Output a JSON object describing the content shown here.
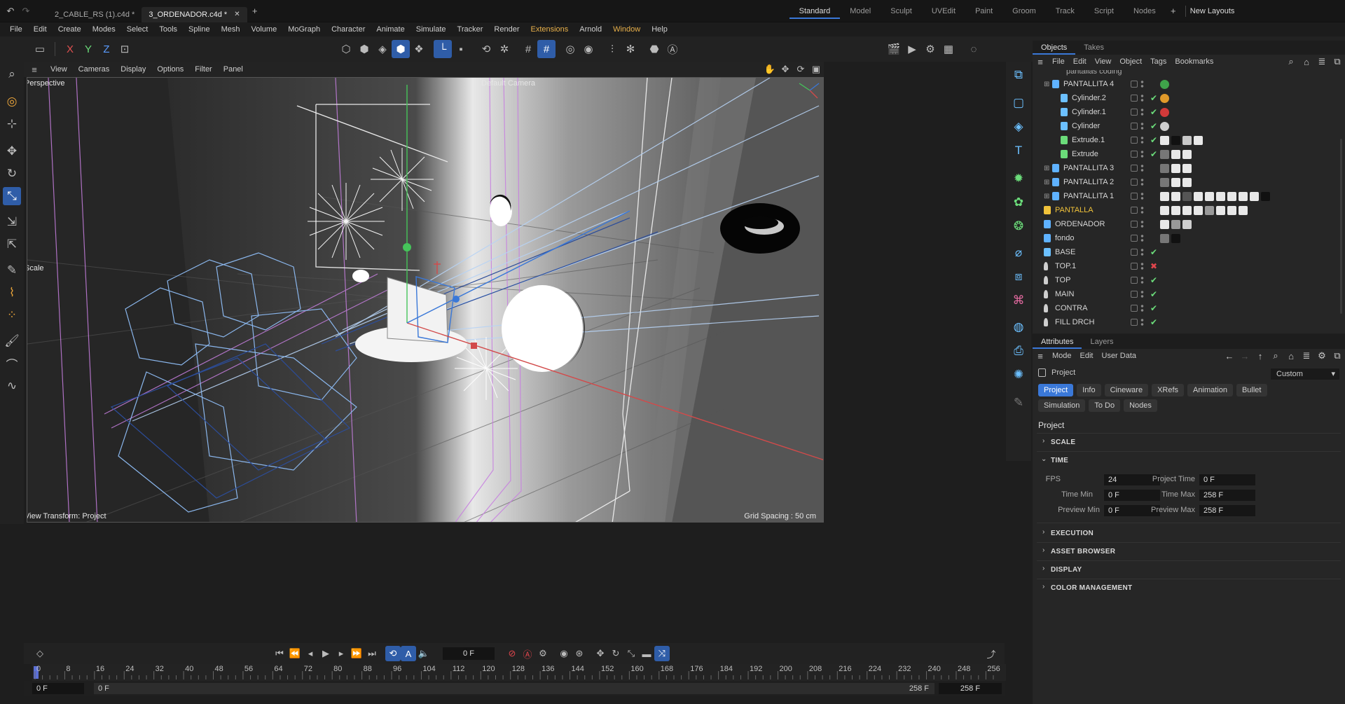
{
  "top_bar": {
    "file_tabs": [
      {
        "label": "2_CABLE_RS (1).c4d *",
        "current": false
      },
      {
        "label": "3_ORDENADOR.c4d *",
        "current": true
      }
    ],
    "add_tab_icon": "plus-icon",
    "layouts": [
      "Standard",
      "Model",
      "Sculpt",
      "UVEdit",
      "Paint",
      "Groom",
      "Track",
      "Script",
      "Nodes"
    ],
    "active_layout": "Standard",
    "new_layouts_label": "New Layouts"
  },
  "menu": [
    "File",
    "Edit",
    "Create",
    "Modes",
    "Select",
    "Tools",
    "Spline",
    "Mesh",
    "Volume",
    "MoGraph",
    "Character",
    "Animate",
    "Simulate",
    "Tracker",
    "Render",
    "Extensions",
    "Arnold",
    "Window",
    "Help"
  ],
  "viewport": {
    "menu": [
      "View",
      "Cameras",
      "Display",
      "Options",
      "Filter",
      "Panel"
    ],
    "projection_label": "Perspective",
    "camera_label": "Default Camera",
    "tool_label": "Scale",
    "view_transform": "View Transform: Project",
    "grid_spacing": "Grid Spacing : 50 cm"
  },
  "objects_panel": {
    "tabs": [
      "Objects",
      "Takes"
    ],
    "active_tab": "Objects",
    "menu": [
      "File",
      "Edit",
      "View",
      "Object",
      "Tags",
      "Bookmarks"
    ],
    "partial_row": "pantallas coding",
    "rows": [
      {
        "name": "PANTALLITA  4",
        "kind": "null",
        "indent": 2,
        "check": "none"
      },
      {
        "name": "Cylinder.2",
        "kind": "cylinder",
        "indent": 3,
        "check": "green"
      },
      {
        "name": "Cylinder.1",
        "kind": "cylinder",
        "indent": 3,
        "check": "green"
      },
      {
        "name": "Cylinder",
        "kind": "cylinder",
        "indent": 3,
        "check": "green"
      },
      {
        "name": "Extrude.1",
        "kind": "extrude",
        "indent": 3,
        "check": "green"
      },
      {
        "name": "Extrude",
        "kind": "extrude",
        "indent": 3,
        "check": "green"
      },
      {
        "name": "PANTALLITA 3",
        "kind": "null",
        "indent": 2,
        "check": "none"
      },
      {
        "name": "PANTALLITA 2",
        "kind": "null",
        "indent": 2,
        "check": "none"
      },
      {
        "name": "PANTALLITA 1",
        "kind": "null",
        "indent": 2,
        "check": "none"
      },
      {
        "name": "PANTALLA",
        "kind": "null-highlight",
        "indent": 1,
        "check": "none"
      },
      {
        "name": "ORDENADOR",
        "kind": "null",
        "indent": 1,
        "check": "none"
      },
      {
        "name": "fondo",
        "kind": "null",
        "indent": 1,
        "check": "none"
      },
      {
        "name": "BASE",
        "kind": "cylinder",
        "indent": 1,
        "check": "green"
      },
      {
        "name": "TOP.1",
        "kind": "light",
        "indent": 1,
        "check": "red"
      },
      {
        "name": "TOP",
        "kind": "light",
        "indent": 1,
        "check": "green"
      },
      {
        "name": "MAIN",
        "kind": "light",
        "indent": 1,
        "check": "green"
      },
      {
        "name": "CONTRA",
        "kind": "light",
        "indent": 1,
        "check": "green"
      },
      {
        "name": "FILL DRCH",
        "kind": "light",
        "indent": 1,
        "check": "green"
      }
    ]
  },
  "attributes_panel": {
    "tabs": [
      "Attributes",
      "Layers"
    ],
    "active_tab": "Attributes",
    "menu": [
      "Mode",
      "Edit",
      "User Data"
    ],
    "object_label": "Project",
    "preset": "Custom",
    "chips_row1": [
      "Project",
      "Info",
      "Cineware",
      "XRefs",
      "Animation",
      "Bullet"
    ],
    "chips_row2": [
      "Simulation",
      "To Do",
      "Nodes"
    ],
    "active_chip": "Project",
    "heading": "Project",
    "sections": {
      "scale": "SCALE",
      "time": "TIME",
      "execution": "EXECUTION",
      "asset_browser": "ASSET BROWSER",
      "display": "DISPLAY",
      "color_management": "COLOR MANAGEMENT"
    },
    "time_fields": {
      "fps_label": "FPS",
      "fps": "24",
      "project_time_label": "Project Time",
      "project_time": "0 F",
      "time_min_label": "Time Min",
      "time_min": "0 F",
      "time_max_label": "Time Max",
      "time_max": "258 F",
      "preview_min_label": "Preview Min",
      "preview_min": "0 F",
      "preview_max_label": "Preview Max",
      "preview_max": "258 F"
    }
  },
  "timeline": {
    "current_frame": "0 F",
    "ticks": [
      "0",
      "8",
      "16",
      "24",
      "32",
      "40",
      "48",
      "56",
      "64",
      "72",
      "80",
      "88",
      "96",
      "104",
      "112",
      "120",
      "128",
      "136",
      "144",
      "152",
      "160",
      "168",
      "176",
      "184",
      "192",
      "200",
      "208",
      "216",
      "224",
      "232",
      "240",
      "248",
      "256"
    ],
    "range_start": "0 F",
    "range_start_inner": "0 F",
    "range_end_inner": "258 F",
    "range_end": "258 F"
  },
  "colors": {
    "accent_blue": "#3a78d8",
    "menu_orange": "#e8b04a",
    "check_green": "#6bdc7a",
    "check_red": "#e0454c"
  }
}
